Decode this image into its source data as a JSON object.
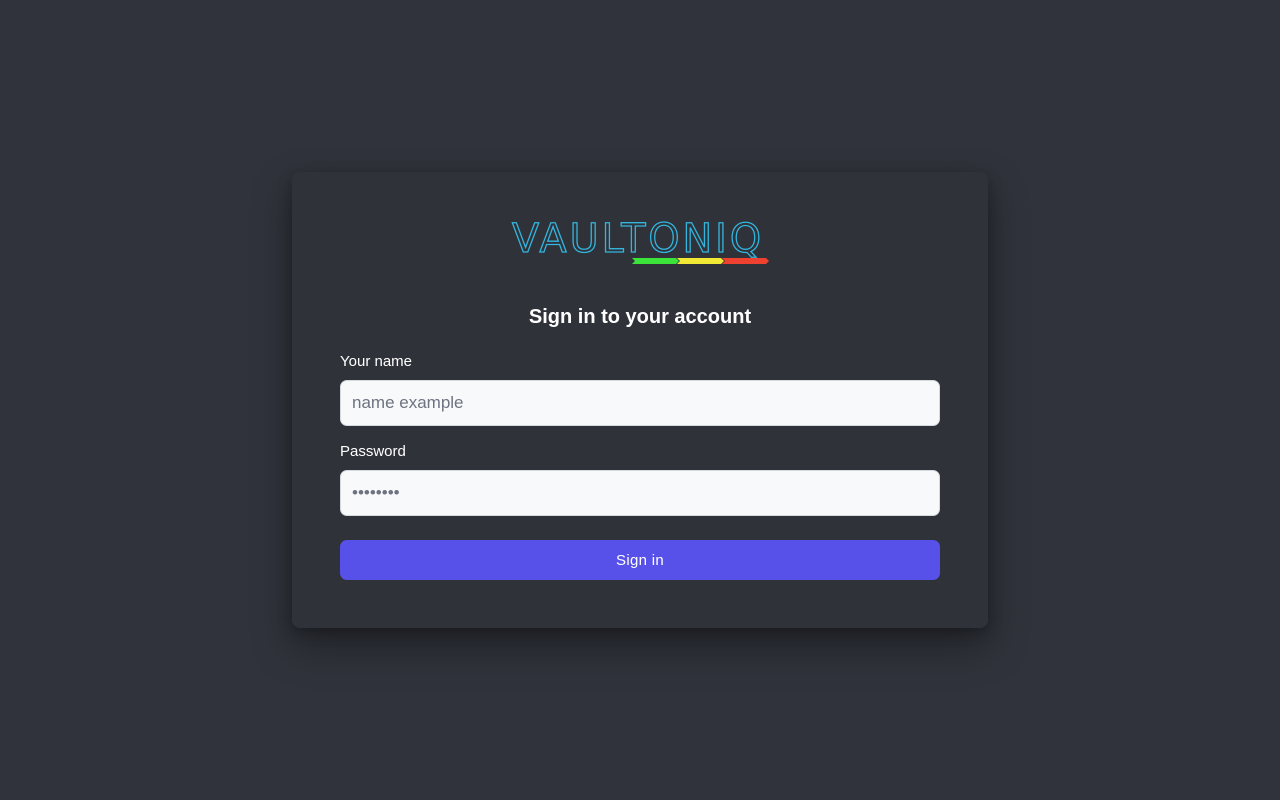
{
  "brand": {
    "name": "VAULTONIQ",
    "text_color": "#33b5de",
    "underline_colors": [
      "#3be33b",
      "#f2e936",
      "#ef4130"
    ]
  },
  "form": {
    "title": "Sign in to your account",
    "name_label": "Your name",
    "name_placeholder": "name example",
    "password_label": "Password",
    "password_placeholder": "••••••••",
    "submit_label": "Sign in"
  },
  "colors": {
    "background": "#30333b",
    "card": "#2f3239",
    "accent": "#5750e9"
  }
}
